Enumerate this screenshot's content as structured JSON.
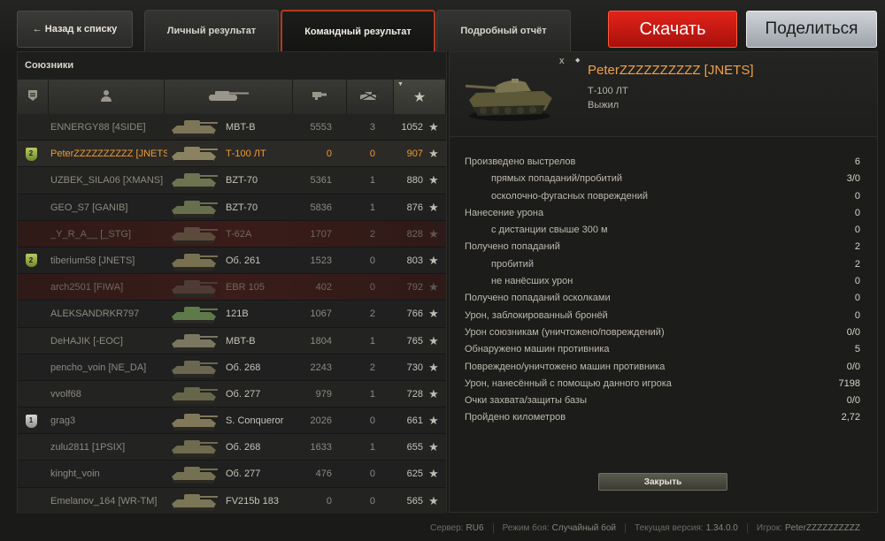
{
  "topbar": {
    "back_label": "← Назад к списку",
    "tabs": [
      {
        "label": "Личный результат"
      },
      {
        "label": "Командный результат"
      },
      {
        "label": "Подробный отчёт"
      }
    ],
    "download_label": "Скачать",
    "share_label": "Поделиться"
  },
  "left_panel": {
    "title": "Союзники",
    "columns": [
      "rank-icon",
      "player-icon",
      "tank-icon",
      "damage-icon",
      "kills-icon",
      "xp-star-icon"
    ],
    "rows": [
      {
        "badge": "",
        "name": "ENNERGY88 [4SIDE]",
        "vehicle": "MBT-B",
        "damage": "5553",
        "kills": "3",
        "xp": "1052",
        "state": "normal"
      },
      {
        "badge": "2",
        "name": "PeterZZZZZZZZZZ [JNETS]",
        "vehicle": "Т-100 ЛТ",
        "damage": "0",
        "kills": "0",
        "xp": "907",
        "state": "player"
      },
      {
        "badge": "",
        "name": "UZBEK_SILA06 [XMANS]",
        "vehicle": "BZT-70",
        "damage": "5361",
        "kills": "1",
        "xp": "880",
        "state": "normal"
      },
      {
        "badge": "",
        "name": "GEO_S7 [GANIB]",
        "vehicle": "BZT-70",
        "damage": "5836",
        "kills": "1",
        "xp": "876",
        "state": "normal"
      },
      {
        "badge": "",
        "name": "_Y_R_A__ [_STG]",
        "vehicle": "T-62A",
        "damage": "1707",
        "kills": "2",
        "xp": "828",
        "state": "dead"
      },
      {
        "badge": "2",
        "name": "tiberium58 [JNETS]",
        "vehicle": "Об. 261",
        "damage": "1523",
        "kills": "0",
        "xp": "803",
        "state": "normal"
      },
      {
        "badge": "",
        "name": "arch2501 [FIWA]",
        "vehicle": "EBR 105",
        "damage": "402",
        "kills": "0",
        "xp": "792",
        "state": "dead"
      },
      {
        "badge": "",
        "name": "ALEKSANDRKR797",
        "vehicle": "121B",
        "damage": "1067",
        "kills": "2",
        "xp": "766",
        "state": "normal"
      },
      {
        "badge": "",
        "name": "DeHAJIK [-EOC]",
        "vehicle": "MBT-B",
        "damage": "1804",
        "kills": "1",
        "xp": "765",
        "state": "normal"
      },
      {
        "badge": "",
        "name": "pencho_voin [NE_DA]",
        "vehicle": "Об. 268",
        "damage": "2243",
        "kills": "2",
        "xp": "730",
        "state": "normal"
      },
      {
        "badge": "",
        "name": "vvolf68",
        "vehicle": "Об. 277",
        "damage": "979",
        "kills": "1",
        "xp": "728",
        "state": "normal"
      },
      {
        "badge": "1",
        "name": "grag3",
        "vehicle": "S. Conqueror",
        "damage": "2026",
        "kills": "0",
        "xp": "661",
        "state": "normal"
      },
      {
        "badge": "",
        "name": "zulu2811 [1PSIX]",
        "vehicle": "Об. 268",
        "damage": "1633",
        "kills": "1",
        "xp": "655",
        "state": "normal"
      },
      {
        "badge": "",
        "name": "kinght_voin",
        "vehicle": "Об. 277",
        "damage": "476",
        "kills": "0",
        "xp": "625",
        "state": "normal"
      },
      {
        "badge": "",
        "name": "Emelanov_164 [WR-TM]",
        "vehicle": "FV215b 183",
        "damage": "0",
        "kills": "0",
        "xp": "565",
        "state": "normal"
      }
    ]
  },
  "right_panel": {
    "close_symbol": "x",
    "player_name": "PeterZZZZZZZZZZ [JNETS]",
    "tank_name": "Т-100 ЛТ",
    "status": "Выжил",
    "stats": [
      {
        "label": "Произведено выстрелов",
        "value": "6",
        "sub": false
      },
      {
        "label": "прямых попаданий/пробитий",
        "value": "3/0",
        "sub": true
      },
      {
        "label": "осколочно-фугасных повреждений",
        "value": "0",
        "sub": true
      },
      {
        "label": "Нанесение урона",
        "value": "0",
        "sub": false
      },
      {
        "label": "с дистанции свыше 300 м",
        "value": "0",
        "sub": true
      },
      {
        "label": "Получено попаданий",
        "value": "2",
        "sub": false
      },
      {
        "label": "пробитий",
        "value": "2",
        "sub": true
      },
      {
        "label": "не нанёсших урон",
        "value": "0",
        "sub": true
      },
      {
        "label": "Получено попаданий осколками",
        "value": "0",
        "sub": false
      },
      {
        "label": "Урон, заблокированный бронёй",
        "value": "0",
        "sub": false
      },
      {
        "label": "Урон союзникам (уничтожено/повреждений)",
        "value": "0/0",
        "sub": false
      },
      {
        "label": "Обнаружено машин противника",
        "value": "5",
        "sub": false
      },
      {
        "label": "Повреждено/уничтожено машин противника",
        "value": "0/0",
        "sub": false
      },
      {
        "label": "Урон, нанесённый с помощью данного игрока",
        "value": "7198",
        "sub": false
      },
      {
        "label": "Очки захвата/защиты базы",
        "value": "0/0",
        "sub": false
      },
      {
        "label": "Пройдено километров",
        "value": "2,72",
        "sub": false
      }
    ],
    "close_label": "Закрыть"
  },
  "footer": [
    {
      "label": "Сервер:",
      "value": "RU6"
    },
    {
      "label": "Режим боя:",
      "value": "Случайный бой"
    },
    {
      "label": "Текущая версия:",
      "value": "1.34.0.0"
    },
    {
      "label": "Игрок:",
      "value": "PeterZZZZZZZZZZ"
    }
  ]
}
